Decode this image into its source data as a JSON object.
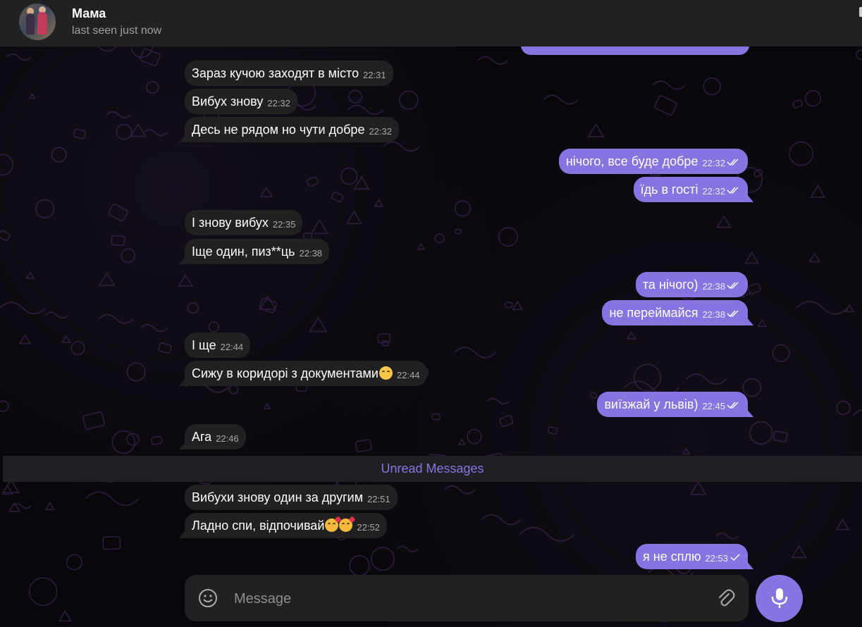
{
  "header": {
    "contact_name": "Мама",
    "status": "last seen just now",
    "avatar_icon": "profile-photo"
  },
  "messages": [
    {
      "dir": "in",
      "text": "Зараз кучою заходят в місто",
      "time": "22:31"
    },
    {
      "dir": "in",
      "text": "Вибух знову",
      "time": "22:32"
    },
    {
      "dir": "in",
      "text": "Десь не рядом но чути добре",
      "time": "22:32"
    },
    {
      "dir": "out",
      "text": "нічого, все буде добре",
      "time": "22:32",
      "status": "read"
    },
    {
      "dir": "out",
      "text": "їдь в гості",
      "time": "22:32",
      "status": "read"
    },
    {
      "dir": "in",
      "text": "І знову вибух",
      "time": "22:35"
    },
    {
      "dir": "in",
      "text": "Іще один, пиз**ць",
      "time": "22:38"
    },
    {
      "dir": "out",
      "text": "та нічого)",
      "time": "22:38",
      "status": "read"
    },
    {
      "dir": "out",
      "text": "не переймайся",
      "time": "22:38",
      "status": "read"
    },
    {
      "dir": "in",
      "text": "І ще",
      "time": "22:44"
    },
    {
      "dir": "in",
      "text": "Сижу в коридорі з документами",
      "time": "22:44",
      "emoji": "grinning-face-emoji"
    },
    {
      "dir": "out",
      "text": "виїзжай у львів)",
      "time": "22:45",
      "status": "read"
    },
    {
      "dir": "in",
      "text": "Ага",
      "time": "22:46"
    },
    {
      "dir": "in",
      "text": "Вибухи знову один за другим",
      "time": "22:51"
    },
    {
      "dir": "in",
      "text": "Ладно спи, відпочивай",
      "time": "22:52",
      "emoji": "kissing-face-emoji x2"
    },
    {
      "dir": "out",
      "text": "я не сплю",
      "time": "22:53",
      "status": "sent"
    }
  ],
  "unread_label": "Unread Messages",
  "composer": {
    "placeholder": "Message",
    "emoji_icon": "smile-icon",
    "attach_icon": "paperclip-icon",
    "mic_icon": "microphone-icon"
  },
  "colors": {
    "accent": "#8774e1",
    "incoming_bubble": "#212121",
    "header_bg": "#212121",
    "chat_bg": "#08080c"
  }
}
